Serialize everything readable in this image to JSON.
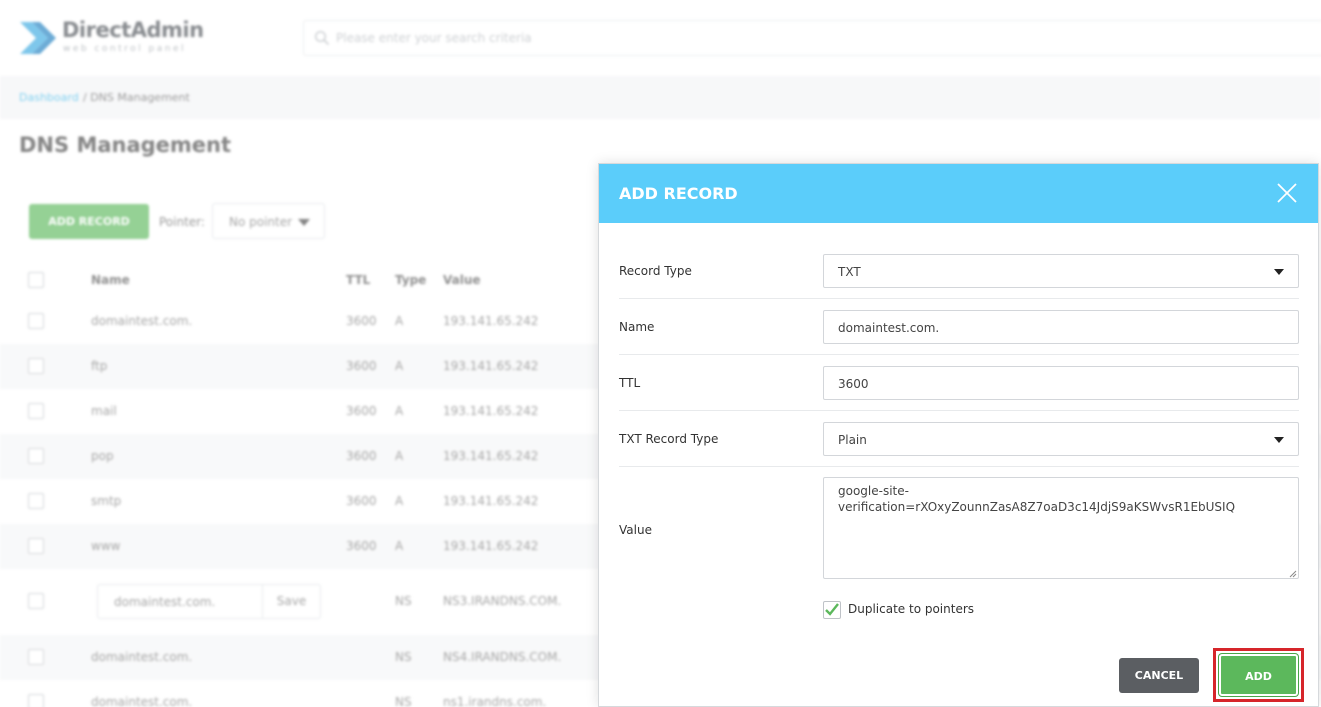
{
  "app": {
    "logo_title": "DirectAdmin",
    "logo_subtitle": "web control panel",
    "search_placeholder": "Please enter your search criteria"
  },
  "breadcrumb": {
    "root": "Dashboard",
    "current": " / DNS Management"
  },
  "page": {
    "title": "DNS Management",
    "add_record_button": "ADD RECORD",
    "pointer_label": "Pointer:",
    "pointer_selected": "No pointer"
  },
  "table": {
    "headers": {
      "name": "Name",
      "ttl": "TTL",
      "type": "Type",
      "value": "Value"
    },
    "rows": [
      {
        "name": "domaintest.com.",
        "ttl": "3600",
        "type": "A",
        "value": "193.141.65.242"
      },
      {
        "name": "ftp",
        "ttl": "3600",
        "type": "A",
        "value": "193.141.65.242"
      },
      {
        "name": "mail",
        "ttl": "3600",
        "type": "A",
        "value": "193.141.65.242"
      },
      {
        "name": "pop",
        "ttl": "3600",
        "type": "A",
        "value": "193.141.65.242"
      },
      {
        "name": "smtp",
        "ttl": "3600",
        "type": "A",
        "value": "193.141.65.242"
      },
      {
        "name": "www",
        "ttl": "3600",
        "type": "A",
        "value": "193.141.65.242"
      },
      {
        "name": "domaintest.com.",
        "ttl": "",
        "type": "NS",
        "value": "NS3.IRANDNS.COM.",
        "editing": true,
        "save_label": "Save"
      },
      {
        "name": "domaintest.com.",
        "ttl": "",
        "type": "NS",
        "value": "NS4.IRANDNS.COM."
      },
      {
        "name": "domaintest.com.",
        "ttl": "",
        "type": "NS",
        "value": "ns1.irandns.com."
      }
    ]
  },
  "modal": {
    "title": "ADD RECORD",
    "fields": {
      "record_type": {
        "label": "Record Type",
        "value": "TXT"
      },
      "name": {
        "label": "Name",
        "value": "domaintest.com."
      },
      "ttl": {
        "label": "TTL",
        "value": "3600"
      },
      "txt_record_type": {
        "label": "TXT Record Type",
        "value": "Plain"
      },
      "value": {
        "label": "Value",
        "value": "google-site-verification=rXOxyZounnZasA8Z7oaD3c14JdjS9aKSWvsR1EbUSIQ"
      }
    },
    "duplicate_label": "Duplicate to pointers",
    "duplicate_checked": true,
    "cancel_label": "CANCEL",
    "add_label": "ADD"
  },
  "colors": {
    "header_blue": "#5bcdfa",
    "add_green": "#5cb85c",
    "cancel_gray": "#5b5e62",
    "highlight_red": "#d6252a",
    "link_blue": "#3db8e8"
  }
}
